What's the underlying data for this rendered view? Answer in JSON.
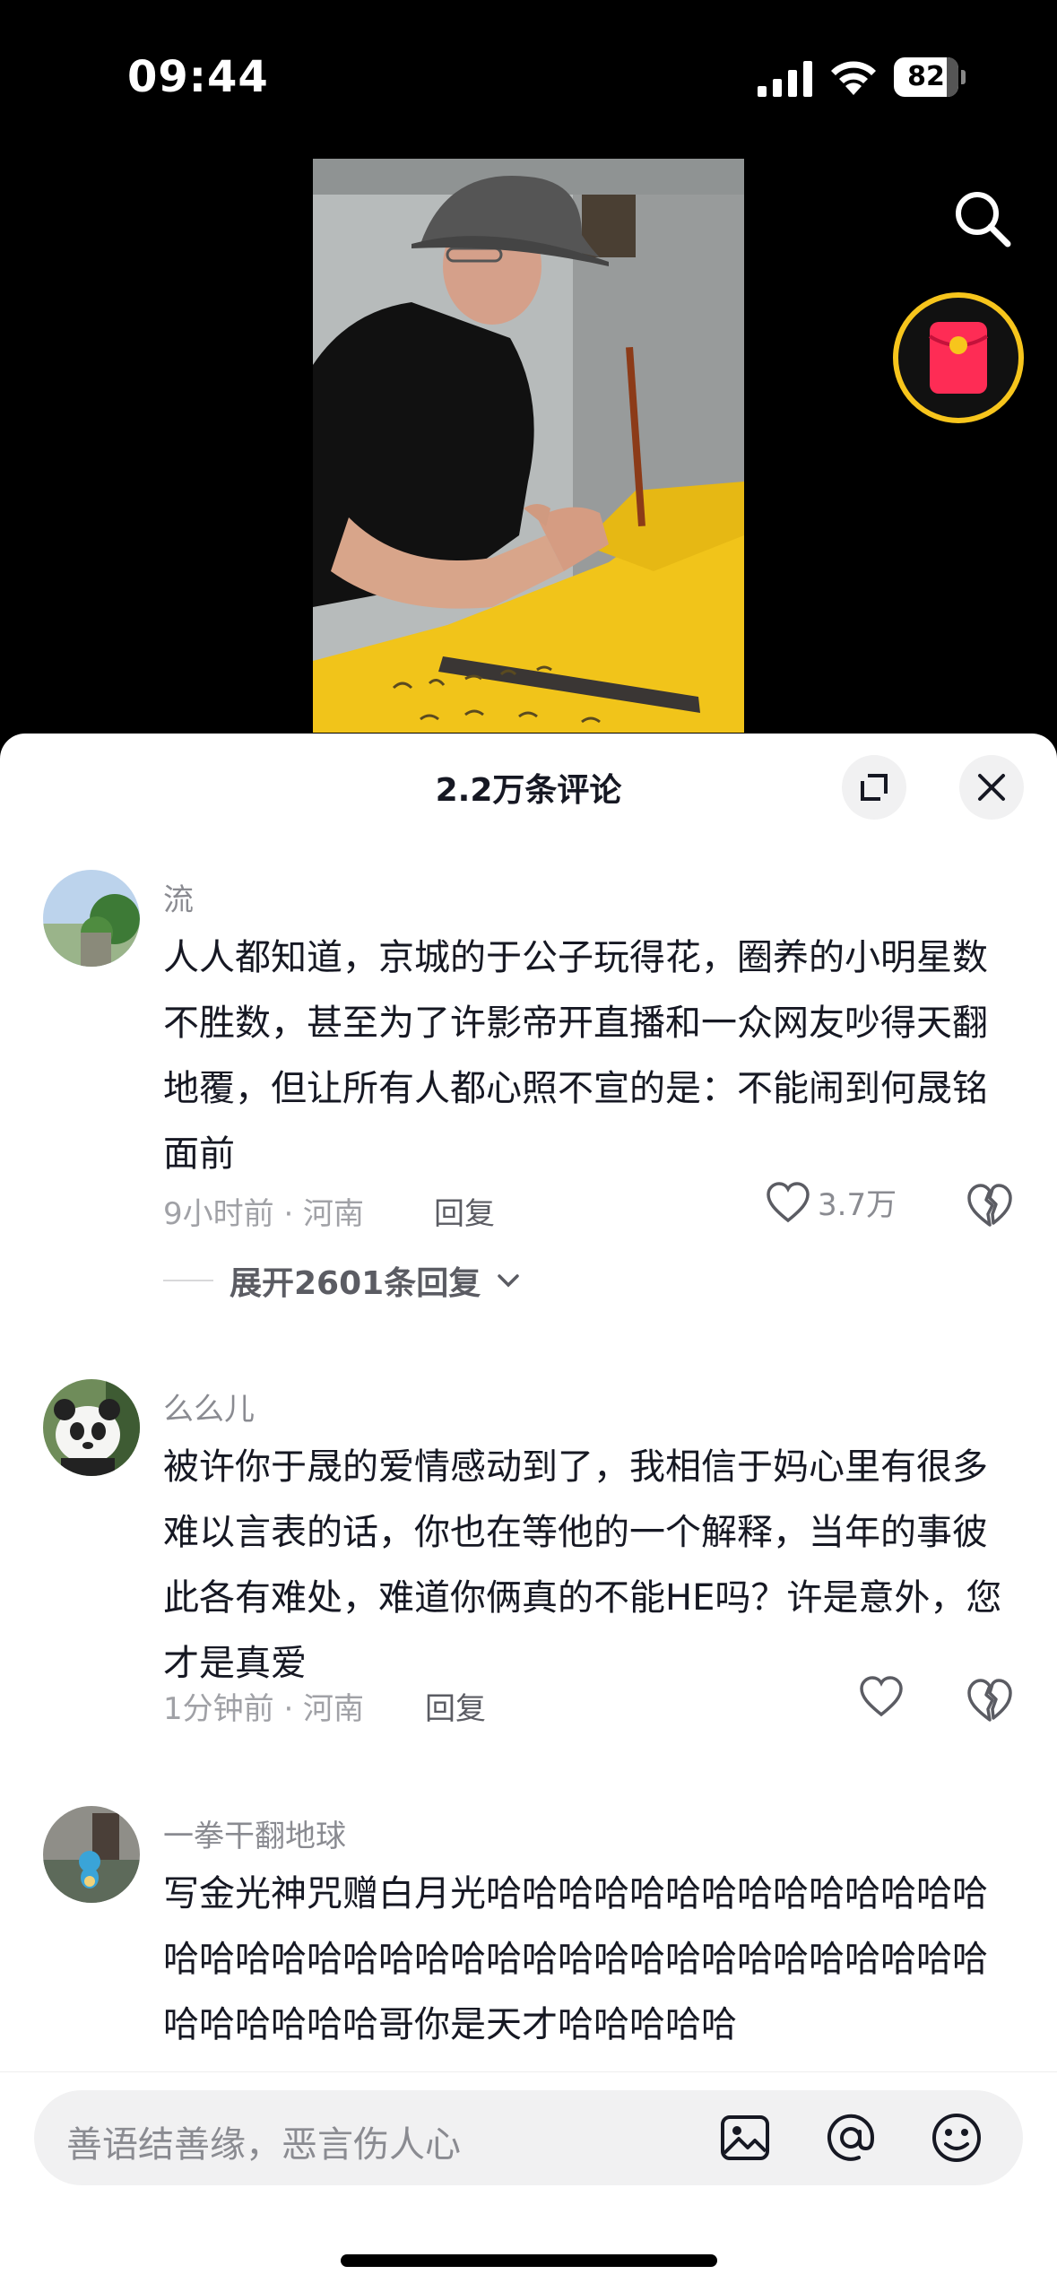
{
  "status_bar": {
    "time": "09:44",
    "battery": "82",
    "battery_level": 0.82
  },
  "video": {
    "description_icon": "video-frame"
  },
  "comments_panel": {
    "title": "2.2万条评论",
    "comments": [
      {
        "author": "流",
        "text": "人人都知道，京城的于公子玩得花，圈养的小明星数不胜数，甚至为了许影帝开直播和一众网友吵得天翻地覆，但让所有人都心照不宣的是：不能闹到何晟铭面前",
        "meta": "9小时前 · 河南",
        "reply_label": "回复",
        "likes": "3.7万",
        "expand_label": "展开2601条回复"
      },
      {
        "author": "么么儿",
        "text": "被许你于晟的爱情感动到了，我相信于妈心里有很多难以言表的话，你也在等他的一个解释，当年的事彼此各有难处，难道你俩真的不能HE吗？许是意外，您才是真爱",
        "meta": "1分钟前 · 河南",
        "reply_label": "回复",
        "likes": ""
      },
      {
        "author": "一拳干翻地球",
        "text": "写金光神咒赠白月光哈哈哈哈哈哈哈哈哈哈哈哈哈哈哈哈哈哈哈哈哈哈哈哈哈哈哈哈哈哈哈哈哈哈哈哈哈哈哈哈哈哈哈哥你是天才哈哈哈哈哈"
      }
    ]
  },
  "input": {
    "placeholder": "善语结善缘，恶言伤人心"
  },
  "colors": {
    "accent_yellow": "#f7c51c",
    "redpacket": "#fe2c55",
    "text": "#161823",
    "muted": "#8a8b91"
  }
}
